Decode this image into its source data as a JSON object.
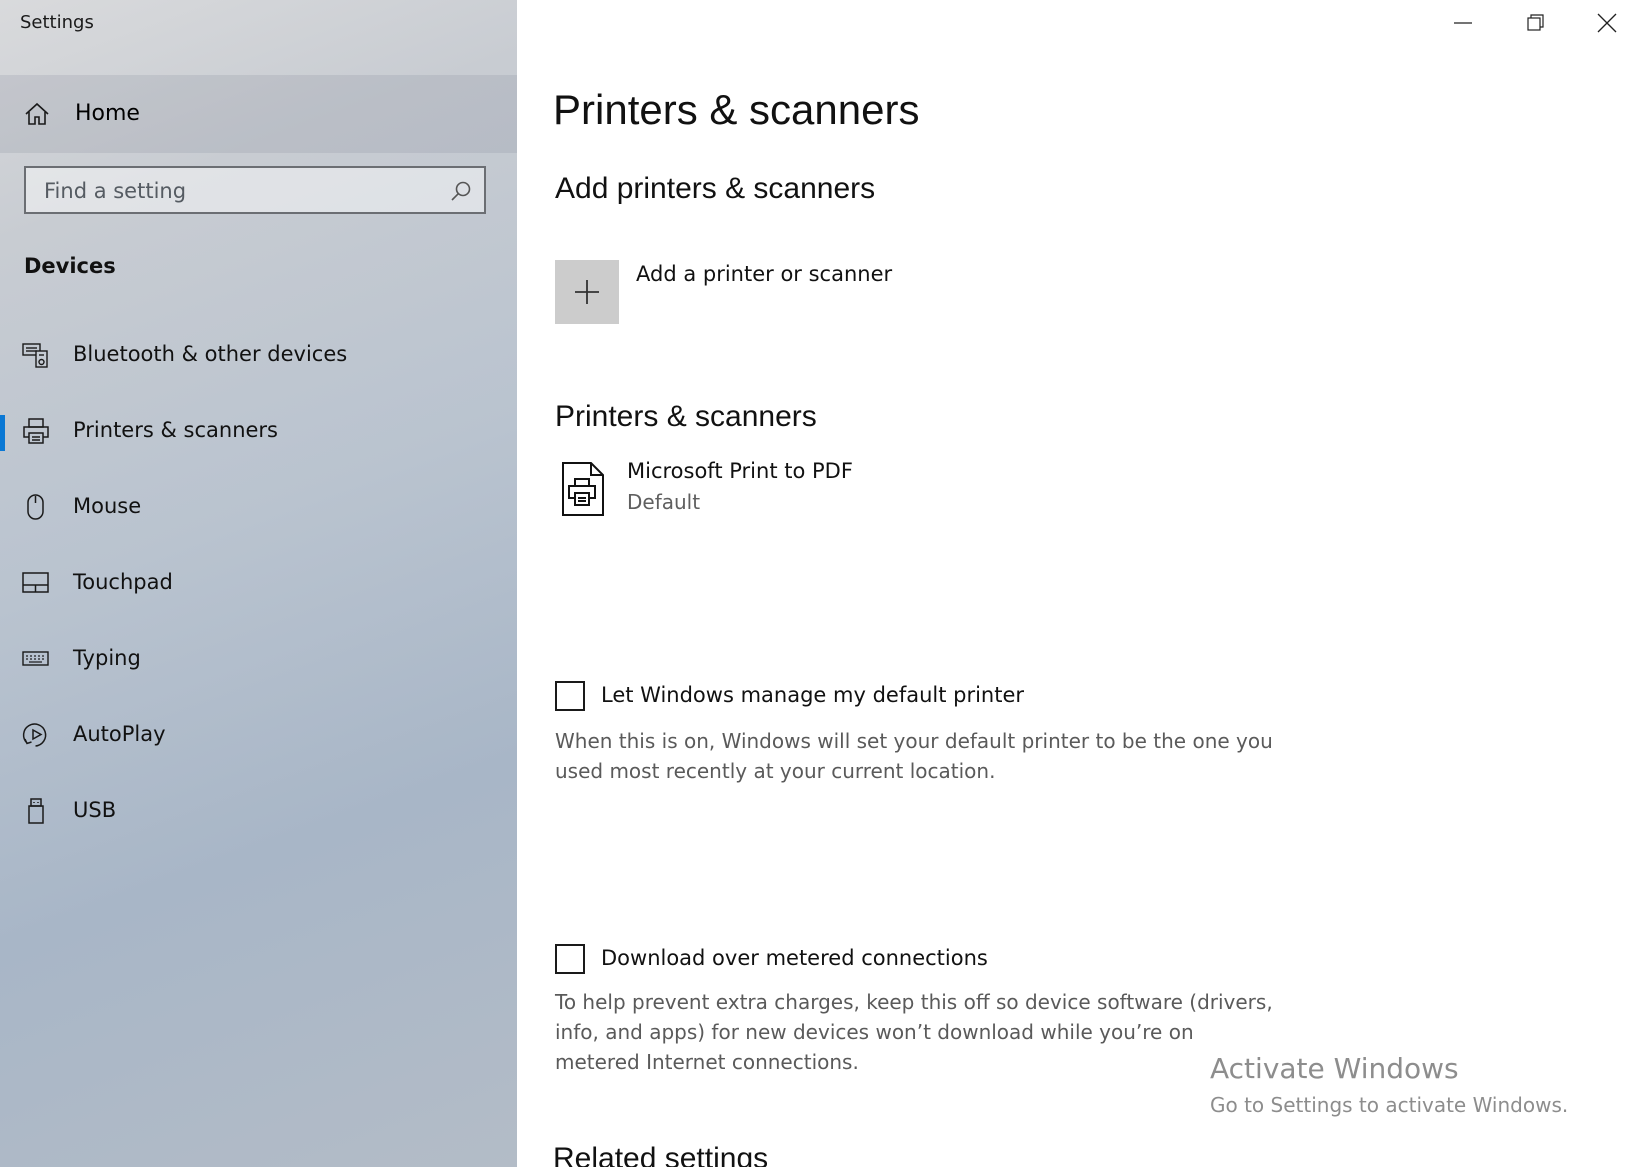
{
  "window": {
    "title": "Settings",
    "buttons": {
      "minimize": "minimize",
      "maximize": "restore",
      "close": "close"
    }
  },
  "sidebar": {
    "home_label": "Home",
    "search": {
      "placeholder": "Find a setting"
    },
    "section_heading": "Devices",
    "items": [
      {
        "label": "Bluetooth & other devices",
        "icon": "bluetooth-devices-icon",
        "selected": false
      },
      {
        "label": "Printers & scanners",
        "icon": "printer-icon",
        "selected": true
      },
      {
        "label": "Mouse",
        "icon": "mouse-icon",
        "selected": false
      },
      {
        "label": "Touchpad",
        "icon": "touchpad-icon",
        "selected": false
      },
      {
        "label": "Typing",
        "icon": "keyboard-icon",
        "selected": false
      },
      {
        "label": "AutoPlay",
        "icon": "autoplay-icon",
        "selected": false
      },
      {
        "label": "USB",
        "icon": "usb-icon",
        "selected": false
      }
    ],
    "accent_color": "#0a78d4"
  },
  "main": {
    "page_title": "Printers & scanners",
    "add_section": {
      "heading": "Add printers & scanners",
      "add_label": "Add a printer or scanner"
    },
    "list_section": {
      "heading": "Printers & scanners",
      "printers": [
        {
          "name": "Microsoft Print to PDF",
          "status": "Default"
        }
      ]
    },
    "manage_default": {
      "label": "Let Windows manage my default printer",
      "checked": false,
      "description": "When this is on, Windows will set your default printer to be the one you used most recently at your current location."
    },
    "metered": {
      "label": "Download over metered connections",
      "checked": false,
      "description": "To help prevent extra charges, keep this off so device software (drivers, info, and apps) for new devices won’t download while you’re on metered Internet connections."
    },
    "related_heading": "Related settings"
  },
  "watermark": {
    "title": "Activate Windows",
    "subtitle": "Go to Settings to activate Windows."
  }
}
